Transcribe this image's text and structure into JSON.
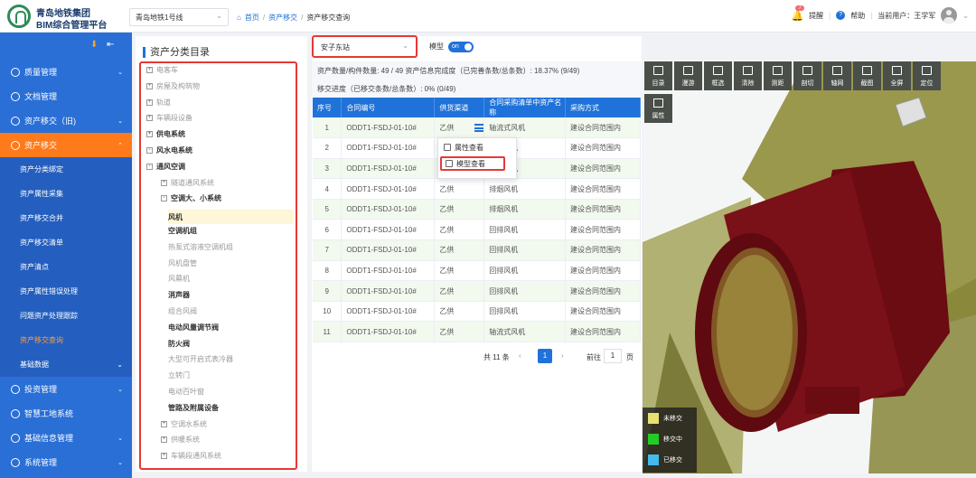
{
  "header": {
    "brand_line1": "青岛地铁集团",
    "brand_line2": "BIM综合管理平台",
    "line_select": "青岛地铁1号线",
    "breadcrumb": [
      "首页",
      "资产移交",
      "资产移交查询"
    ],
    "notify_count": "7",
    "notify_label": "提醒",
    "help_label": "帮助",
    "user_label": "当前用户：王学军"
  },
  "sidebar": {
    "items": [
      {
        "label": "质量管理",
        "icon": "shield-icon",
        "arrow": "down"
      },
      {
        "label": "文档管理",
        "icon": "document-icon",
        "arrow": ""
      },
      {
        "label": "资产移交（旧)",
        "icon": "transfer-icon",
        "arrow": "down"
      },
      {
        "label": "资产移交",
        "icon": "transfer-icon",
        "arrow": "up",
        "active": true
      }
    ],
    "subitems": [
      "资产分类绑定",
      "资产属性采集",
      "资产移交合并",
      "资产移交清单",
      "资产清点",
      "资产属性错误处理",
      "问题资产处理跟踪",
      "资产移交查询"
    ],
    "active_sub": 7,
    "bottom": [
      {
        "label": "基础数据",
        "arrow": "down",
        "sub": true
      },
      {
        "label": "投资管理",
        "arrow": "down"
      },
      {
        "label": "智慧工地系统",
        "arrow": ""
      },
      {
        "label": "基础信息管理",
        "arrow": "down"
      },
      {
        "label": "系统管理",
        "arrow": "down"
      }
    ]
  },
  "tree": {
    "title": "资产分类目录",
    "nodes": [
      {
        "label": "电客车",
        "level": 0,
        "box": "+",
        "style": "g"
      },
      {
        "label": "房屋及构筑物",
        "level": 0,
        "box": "+",
        "style": "g"
      },
      {
        "label": "轨道",
        "level": 0,
        "box": "+",
        "style": "g"
      },
      {
        "label": "车辆段设备",
        "level": 0,
        "box": "+",
        "style": "g"
      },
      {
        "label": "供电系统",
        "level": 0,
        "box": "+",
        "style": "b"
      },
      {
        "label": "风水电系统",
        "level": 0,
        "box": "-",
        "style": "b"
      },
      {
        "label": "通风空调",
        "level": 1,
        "box": "-",
        "style": "b"
      },
      {
        "label": "隧道通风系统",
        "level": 2,
        "box": "+",
        "style": "g"
      },
      {
        "label": "空调大、小系统",
        "level": 2,
        "box": "-",
        "style": "b"
      },
      {
        "label": "风机",
        "level": 3,
        "box": "",
        "style": "b sel"
      },
      {
        "label": "空调机组",
        "level": 3,
        "box": "",
        "style": "b"
      },
      {
        "label": "热泵式溶液空调机组",
        "level": 3,
        "box": "",
        "style": "g"
      },
      {
        "label": "风机盘管",
        "level": 3,
        "box": "",
        "style": "g"
      },
      {
        "label": "风幕机",
        "level": 3,
        "box": "",
        "style": "g"
      },
      {
        "label": "消声器",
        "level": 3,
        "box": "",
        "style": "b"
      },
      {
        "label": "组合风阀",
        "level": 3,
        "box": "",
        "style": "g"
      },
      {
        "label": "电动风量调节阀",
        "level": 3,
        "box": "",
        "style": "b"
      },
      {
        "label": "防火阀",
        "level": 3,
        "box": "",
        "style": "b"
      },
      {
        "label": "大型可开启式表冷器",
        "level": 3,
        "box": "",
        "style": "g"
      },
      {
        "label": "立转门",
        "level": 3,
        "box": "",
        "style": "g"
      },
      {
        "label": "电动百叶窗",
        "level": 3,
        "box": "",
        "style": "g"
      },
      {
        "label": "管路及附属设备",
        "level": 3,
        "box": "",
        "style": "b"
      },
      {
        "label": "空调水系统",
        "level": 2,
        "box": "+",
        "style": "g"
      },
      {
        "label": "供暖系统",
        "level": 2,
        "box": "+",
        "style": "g"
      },
      {
        "label": "车辆段通风系统",
        "level": 2,
        "box": "+",
        "style": "g"
      }
    ]
  },
  "main": {
    "station": "安子东站",
    "model_label": "模型",
    "toggle": "on",
    "stat1": "资产数量/构件数量:   49 / 49    资产信息完成度（已完善条数/总条数）:   18.37%  (9/49)",
    "stat2": "移交进度（已移交条数/总条数）:   0%   (0/49)",
    "columns": [
      "序号",
      "合同编号",
      "供货渠道",
      "合同采购清单中资产名称",
      "采购方式"
    ],
    "rows": [
      [
        "1",
        "ODDT1-FSDJ-01-10#",
        "乙供",
        "轴流式风机",
        "建设合同范围内"
      ],
      [
        "2",
        "ODDT1-FSDJ-01-10#",
        "乙供",
        "排烟风机",
        "建设合同范围内"
      ],
      [
        "3",
        "ODDT1-FSDJ-01-10#",
        "乙供",
        "排烟风机",
        "建设合同范围内"
      ],
      [
        "4",
        "ODDT1-FSDJ-01-10#",
        "乙供",
        "排烟风机",
        "建设合同范围内"
      ],
      [
        "5",
        "ODDT1-FSDJ-01-10#",
        "乙供",
        "排烟风机",
        "建设合同范围内"
      ],
      [
        "6",
        "ODDT1-FSDJ-01-10#",
        "乙供",
        "回排风机",
        "建设合同范围内"
      ],
      [
        "7",
        "ODDT1-FSDJ-01-10#",
        "乙供",
        "回排风机",
        "建设合同范围内"
      ],
      [
        "8",
        "ODDT1-FSDJ-01-10#",
        "乙供",
        "回排风机",
        "建设合同范围内"
      ],
      [
        "9",
        "ODDT1-FSDJ-01-10#",
        "乙供",
        "回排风机",
        "建设合同范围内"
      ],
      [
        "10",
        "ODDT1-FSDJ-01-10#",
        "乙供",
        "回排风机",
        "建设合同范围内"
      ],
      [
        "11",
        "ODDT1-FSDJ-01-10#",
        "乙供",
        "轴流式风机",
        "建设合同范围内"
      ]
    ],
    "context_menu": [
      "属性查看",
      "模型查看"
    ],
    "pager": {
      "total": "共 11 条",
      "page": "1",
      "goto": "前往",
      "page_input": "1",
      "unit": "页"
    }
  },
  "viewer": {
    "toolbar": [
      "目录",
      "漫游",
      "框选",
      "清除",
      "测距",
      "剖切",
      "轴网",
      "截图",
      "全屏",
      "定位"
    ],
    "toolbar2": "属性",
    "legend": [
      {
        "label": "未移交",
        "color": "#e8e070"
      },
      {
        "label": "移交中",
        "color": "#22cc22"
      },
      {
        "label": "已移交",
        "color": "#44bbee"
      }
    ],
    "colors": {
      "fan": "#7a1018",
      "tunnel": "#8f8e3a"
    }
  }
}
